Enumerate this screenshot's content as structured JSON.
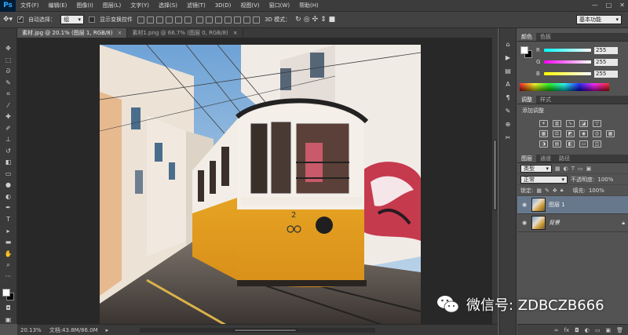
{
  "app": {
    "logo": "Ps"
  },
  "menu": [
    "文件(F)",
    "编辑(E)",
    "图像(I)",
    "图层(L)",
    "文字(Y)",
    "选择(S)",
    "滤镜(T)",
    "3D(D)",
    "视图(V)",
    "窗口(W)",
    "帮助(H)"
  ],
  "window_controls": [
    "—",
    "□",
    "✕"
  ],
  "options_bar": {
    "auto_select_label": "自动选择：",
    "auto_select_checked": true,
    "auto_select_value": "组",
    "show_transform_label": "显示变换控件",
    "show_transform_checked": false,
    "mode_3d_label": "3D 模式：",
    "workspace": "基本功能"
  },
  "tabs": [
    {
      "label": "素材.jpg @ 20.1% (图层 1, RGB/8)",
      "close": "×",
      "active": true
    },
    {
      "label": "素材1.png @ 66.7% (图层 0, RGB/8)",
      "close": "×",
      "active": false
    }
  ],
  "status": {
    "zoom": "20.13%",
    "doc": "文档:43.8M/86.0M"
  },
  "color_panel": {
    "tabs": [
      "颜色",
      "色板"
    ],
    "foreground": "#ffffff",
    "background": "#000000",
    "channels": [
      {
        "label": "R",
        "value": "255"
      },
      {
        "label": "G",
        "value": "255"
      },
      {
        "label": "B",
        "value": "255"
      }
    ]
  },
  "adjustments_panel": {
    "tabs": [
      "调整",
      "样式"
    ],
    "title": "添加调整"
  },
  "layers_panel": {
    "tabs": [
      "图层",
      "通道",
      "路径"
    ],
    "filter": "类型",
    "blend_mode": "正常",
    "opacity_label": "不透明度:",
    "opacity": "100%",
    "lock_label": "锁定:",
    "fill_label": "填充:",
    "fill": "100%",
    "layers": [
      {
        "name": "图层 1",
        "selected": true,
        "locked": false
      },
      {
        "name": "背景",
        "selected": false,
        "locked": true
      }
    ]
  },
  "watermark": {
    "text": "微信号: ZDBCZB666"
  }
}
